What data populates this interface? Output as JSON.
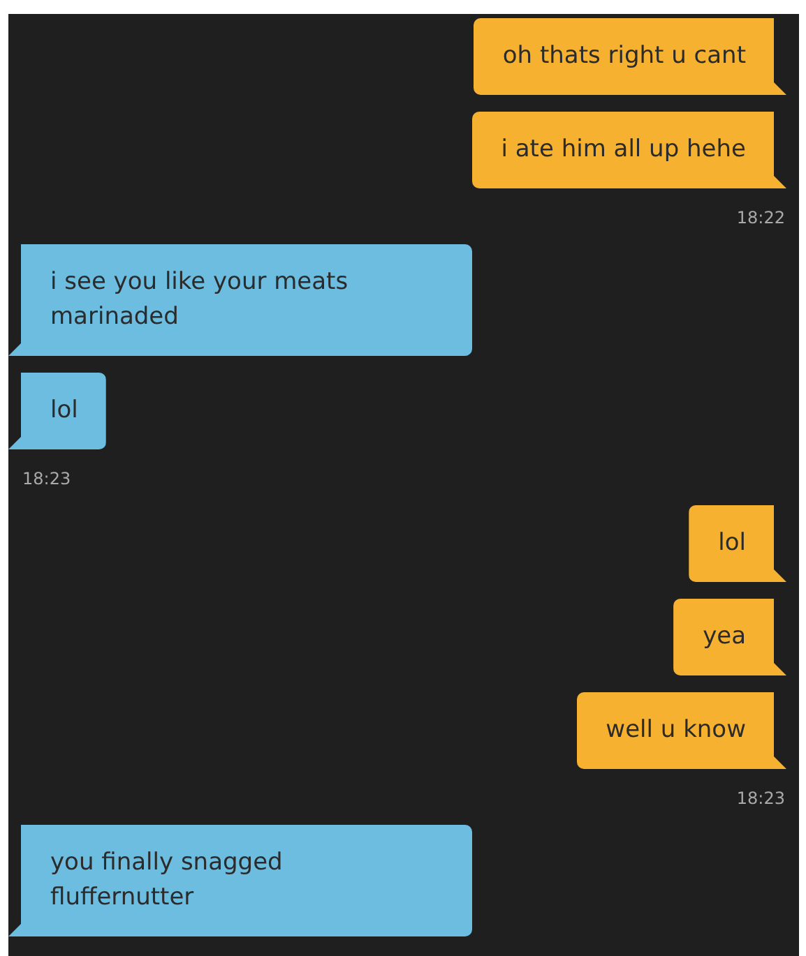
{
  "groups": [
    {
      "kind": "sent",
      "messages": [
        "oh thats right u cant",
        "i ate him all up hehe"
      ],
      "time": "18:22"
    },
    {
      "kind": "received",
      "messages": [
        "i see you like your meats marinaded",
        "lol"
      ],
      "time": "18:23"
    },
    {
      "kind": "sent",
      "messages": [
        "lol",
        "yea",
        "well u know"
      ],
      "time": "18:23"
    },
    {
      "kind": "received",
      "messages": [
        "you finally snagged fluffernutter"
      ]
    }
  ]
}
